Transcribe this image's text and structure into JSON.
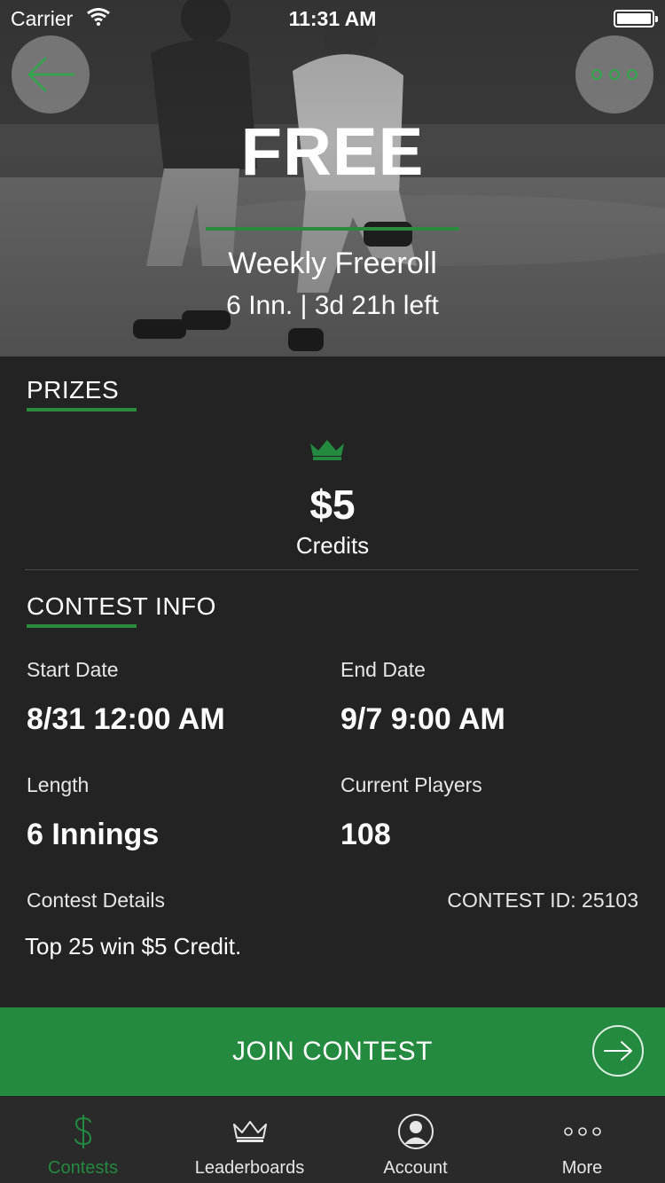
{
  "status_bar": {
    "carrier": "Carrier",
    "time": "11:31 AM"
  },
  "hero": {
    "title": "FREE",
    "subtitle": "Weekly Freeroll",
    "meta": "6 Inn. | 3d 21h left",
    "back_icon": "arrow-left-icon",
    "menu_icon": "more-dots-icon"
  },
  "prizes": {
    "heading": "PRIZES",
    "icon": "crown-icon",
    "amount": "$5",
    "unit": "Credits"
  },
  "contest_info": {
    "heading": "CONTEST INFO",
    "start_label": "Start Date",
    "start_value": "8/31 12:00 AM",
    "end_label": "End Date",
    "end_value": "9/7 9:00 AM",
    "length_label": "Length",
    "length_value": "6 Innings",
    "players_label": "Current Players",
    "players_value": "108",
    "details_label": "Contest Details",
    "contest_id": "CONTEST ID: 25103",
    "details_text": "Top 25 win $5 Credit."
  },
  "join": {
    "label": "JOIN CONTEST",
    "icon": "arrow-right-circle-icon"
  },
  "tabs": [
    {
      "label": "Contests",
      "icon": "dollar-icon",
      "active": true
    },
    {
      "label": "Leaderboards",
      "icon": "crown-icon",
      "active": false
    },
    {
      "label": "Account",
      "icon": "user-icon",
      "active": false
    },
    {
      "label": "More",
      "icon": "more-dots-icon",
      "active": false
    }
  ],
  "colors": {
    "accent": "#238a3f",
    "background": "#232323",
    "tab_bar": "#2a2a2a"
  }
}
